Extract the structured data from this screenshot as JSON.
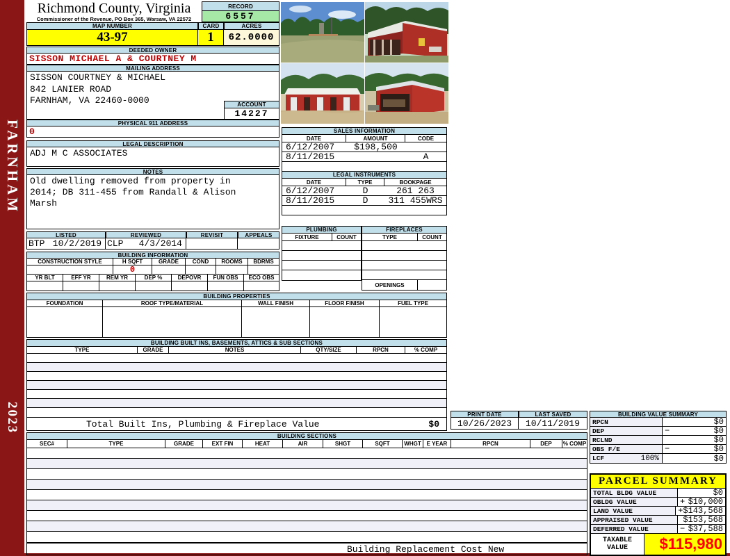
{
  "sidebar": {
    "district": "FARNHAM",
    "year": "2023"
  },
  "header": {
    "county": "Richmond County, Virginia",
    "commissioner": "Commissioner of the Revenue, PO Box 365, Warsaw, VA 22572",
    "record_label": "RECORD",
    "record": "6557",
    "map_label": "MAP NUMBER",
    "map_number": "43-97",
    "card_label": "CARD",
    "card": "1",
    "acres_label": "ACRES",
    "acres": "62.0000"
  },
  "owner": {
    "deeded_label": "DEEDED OWNER",
    "deeded": "SISSON MICHAEL A & COURTNEY M",
    "mailing_label": "MAILING ADDRESS",
    "mailing_lines": [
      "SISSON COURTNEY & MICHAEL",
      "842 LANIER ROAD",
      "",
      "FARNHAM, VA 22460-0000"
    ],
    "account_label": "ACCOUNT",
    "account": "14227",
    "physical_label": "PHYSICAL 911 ADDRESS",
    "physical": "0"
  },
  "legal": {
    "label": "LEGAL DESCRIPTION",
    "text": "ADJ M C ASSOCIATES"
  },
  "notes": {
    "label": "NOTES",
    "lines": [
      "Old dwelling removed from property in",
      "2014; DB 311-455 from Randall & Alison",
      "Marsh"
    ]
  },
  "review": {
    "listed_label": "LISTED",
    "listed_by": "BTP",
    "listed_date": "10/2/2019",
    "reviewed_label": "REVIEWED",
    "reviewed_by": "CLP",
    "reviewed_date": "4/3/2014",
    "revisit_label": "REVISIT",
    "appeals_label": "APPEALS"
  },
  "photos": [
    {
      "desc": "Open grass field with utility pole and tree line"
    },
    {
      "desc": "Red barn with white metal roof seen from front corner"
    },
    {
      "desc": "Long red stable barn with white roof and dirt yard"
    },
    {
      "desc": "Red equipment barn with open bay and stored machinery"
    }
  ],
  "sales": {
    "title": "SALES INFORMATION",
    "columns": [
      "DATE",
      "AMOUNT",
      "CODE"
    ],
    "rows": [
      {
        "date": "6/12/2007",
        "amount": "$198,500",
        "code": ""
      },
      {
        "date": "8/11/2015",
        "amount": "",
        "code": "A"
      }
    ]
  },
  "instruments": {
    "title": "LEGAL INSTRUMENTS",
    "columns": [
      "DATE",
      "TYPE",
      "BOOKPAGE"
    ],
    "rows": [
      {
        "date": "6/12/2007",
        "type": "D",
        "bookpage": "261 263"
      },
      {
        "date": "8/11/2015",
        "type": "D",
        "bookpage": "311 455WRS"
      }
    ]
  },
  "plumbing": {
    "title": "PLUMBING",
    "columns": [
      "FIXTURE",
      "COUNT"
    ]
  },
  "fireplaces": {
    "title": "FIREPLACES",
    "columns": [
      "TYPE",
      "COUNT"
    ],
    "openings_label": "OPENINGS"
  },
  "building_info": {
    "title": "BUILDING INFORMATION",
    "row1_columns": [
      "CONSTRUCTION STYLE",
      "H SQFT",
      "GRADE",
      "COND",
      "ROOMS",
      "BDRMS"
    ],
    "h_sqft": "0",
    "row2_columns": [
      "YR BLT",
      "EFF YR",
      "REM YR",
      "DEP %",
      "DEPOVR",
      "FUN OBS",
      "ECO OBS"
    ]
  },
  "building_properties": {
    "title": "BUILDING PROPERTIES",
    "columns": [
      "FOUNDATION",
      "ROOF TYPE/MATERIAL",
      "WALL FINISH",
      "FLOOR FINISH",
      "FUEL TYPE"
    ]
  },
  "built_ins": {
    "title": "BUILDING BUILT INS, BASEMENTS, ATTICS & SUB SECTIONS",
    "columns": [
      "TYPE",
      "GRADE",
      "NOTES",
      "QTY/SIZE",
      "RPCN",
      "% COMP"
    ],
    "total_label": "Total Built Ins, Plumbing & Fireplace Value",
    "total_value": "$0"
  },
  "print_info": {
    "print_date_label": "PRINT DATE",
    "print_date": "10/26/2023",
    "last_saved_label": "LAST SAVED",
    "last_saved": "10/11/2019"
  },
  "building_sections": {
    "title": "BUILDING SECTIONS",
    "columns": [
      "SEC#",
      "TYPE",
      "GRADE",
      "EXT FIN",
      "HEAT",
      "AIR",
      "SHGT",
      "SQFT",
      "WHGT",
      "E YEAR",
      "RPCN",
      "DEP",
      "% COMP"
    ]
  },
  "value_summary": {
    "title": "BUILDING VALUE SUMMARY",
    "rows": [
      {
        "label": "RPCN",
        "op": "",
        "value": "$0"
      },
      {
        "label": "DEP",
        "op": "−",
        "value": "$0"
      },
      {
        "label": "RCLND",
        "op": "",
        "value": "$0"
      },
      {
        "label": "OBS F/E",
        "op": "−",
        "value": "$0"
      },
      {
        "label": "LCF",
        "pct": "100%",
        "op": "",
        "value": "$0"
      }
    ]
  },
  "parcel_summary": {
    "title": "PARCEL SUMMARY",
    "rows": [
      {
        "label": "TOTAL BLDG VALUE",
        "op": "",
        "value": "$0"
      },
      {
        "label": "OBLDG VALUE",
        "op": "+",
        "value": "$10,000"
      },
      {
        "label": "LAND VALUE",
        "op": "+",
        "value": "$143,568"
      },
      {
        "label": "APPRAISED VALUE",
        "op": "",
        "value": "$153,568"
      },
      {
        "label": "DEFERRED VALUE",
        "op": "−",
        "value": "$37,588"
      }
    ],
    "taxable_label": "TAXABLE VALUE",
    "taxable_value": "$115,980"
  },
  "footer": {
    "brcn_label": "Building Replacement Cost New"
  }
}
